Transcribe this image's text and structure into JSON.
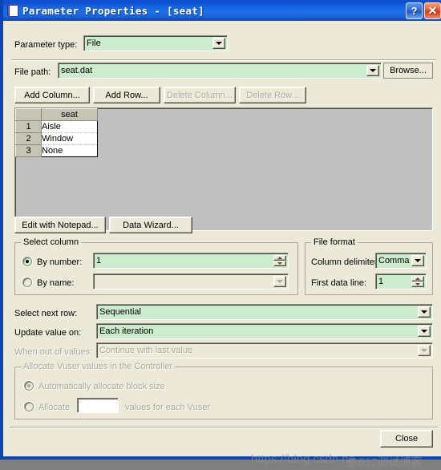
{
  "window": {
    "title": "Parameter Properties - [seat]",
    "icon": "document-icon",
    "help_button": "?",
    "close_button": "✕",
    "accent_color": "#0a44b5",
    "dialog_bg": "#ece9d8",
    "field_bg": "#cdebcd"
  },
  "parameter_type": {
    "label": "Parameter type:",
    "value": "File"
  },
  "file_path": {
    "label": "File path:",
    "value": "seat.dat",
    "browse_label": "Browse..."
  },
  "grid_toolbar": {
    "add_column": "Add Column...",
    "add_row": "Add Row...",
    "delete_column": "Delete Column...",
    "delete_row": "Delete Row..."
  },
  "grid": {
    "columns": [
      "seat"
    ],
    "rows": [
      {
        "num": "1",
        "cells": [
          "Aisle"
        ]
      },
      {
        "num": "2",
        "cells": [
          "Window"
        ]
      },
      {
        "num": "3",
        "cells": [
          "None"
        ]
      }
    ]
  },
  "grid_buttons": {
    "edit_with_notepad": "Edit with Notepad...",
    "data_wizard": "Data Wizard..."
  },
  "select_column": {
    "title": "Select column",
    "by_number_label": "By number:",
    "by_number_value": "1",
    "by_number_selected": true,
    "by_name_label": "By name:",
    "by_name_value": "",
    "by_name_selected": false
  },
  "file_format": {
    "title": "File format",
    "column_delimiter_label": "Column delimiter:",
    "column_delimiter_value": "Comma",
    "first_data_line_label": "First data line:",
    "first_data_line_value": "1"
  },
  "row_options": {
    "select_next_row_label": "Select next row:",
    "select_next_row_value": "Sequential",
    "update_value_on_label": "Update value on:",
    "update_value_on_value": "Each iteration",
    "when_out_of_values_label": "When out of values:",
    "when_out_of_values_value": "Continue with last value"
  },
  "allocate": {
    "title": "Allocate Vuser values in the Controller",
    "auto_label": "Automatically allocate block size",
    "auto_selected": true,
    "manual_prefix": "Allocate",
    "manual_value": "",
    "manual_suffix": "values for each Vuser",
    "manual_selected": false
  },
  "footer": {
    "close_label": "Close"
  },
  "watermark": {
    "text": "https://blog.csdn.ne",
    "text2": "@512测试博客"
  }
}
